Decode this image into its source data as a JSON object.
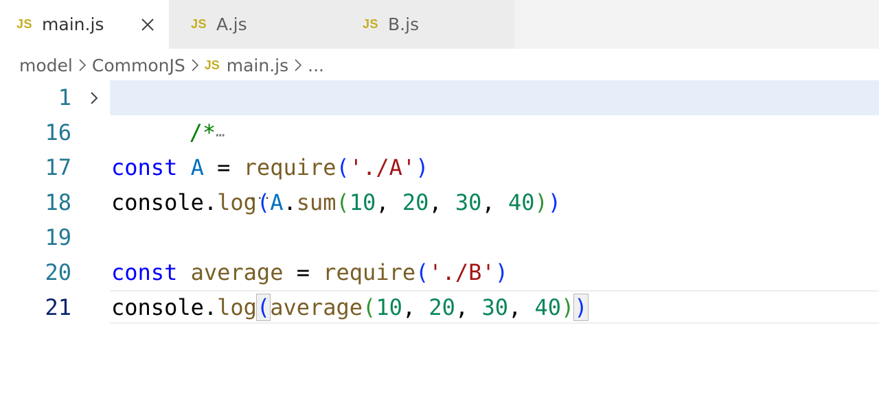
{
  "tabs": [
    {
      "icon_text": "JS",
      "label": "main.js",
      "active": true,
      "close_icon": "close-icon"
    },
    {
      "icon_text": "JS",
      "label": "A.js",
      "active": false
    },
    {
      "icon_text": "JS",
      "label": "B.js",
      "active": false
    }
  ],
  "breadcrumb": {
    "folder1": "model",
    "folder2": "CommonJS",
    "file_icon_text": "JS",
    "file": "main.js",
    "more": "..."
  },
  "editor": {
    "lines": [
      {
        "number": "1",
        "folded": true,
        "comment_start": "/*",
        "fold_ellipsis": "⋯"
      },
      {
        "number": "16"
      },
      {
        "number": "17",
        "tokens": {
          "kw": "const",
          "var": "A",
          "op": "=",
          "fn": "require",
          "open": "(",
          "str": "'./A'",
          "close": ")"
        }
      },
      {
        "number": "18",
        "tokens": {
          "obj": "console",
          "dot": ".",
          "fn": "log",
          "open1": "(",
          "var": "A",
          "dot2": ".",
          "fn2": "sum",
          "open2": "(",
          "n1": "10",
          "n2": "20",
          "n3": "30",
          "n4": "40",
          "close2": ")",
          "close1": ")"
        }
      },
      {
        "number": "19"
      },
      {
        "number": "20",
        "tokens": {
          "kw": "const",
          "fn": "average",
          "op": "=",
          "fn2": "require",
          "open": "(",
          "str": "'./B'",
          "close": ")"
        }
      },
      {
        "number": "21",
        "current": true,
        "tokens": {
          "obj": "console",
          "dot": ".",
          "fn": "log",
          "open1": "(",
          "fn2": "average",
          "open2": "(",
          "n1": "10",
          "n2": "20",
          "n3": "30",
          "n4": "40",
          "close2": ")",
          "close1": ")"
        }
      }
    ],
    "inline_hint": "..."
  },
  "colors": {
    "js_icon": "#c4ad22",
    "keyword": "#0000ff",
    "variable": "#0070c1",
    "function": "#795e26",
    "string": "#a31515",
    "number": "#098658",
    "comment": "#008000",
    "line_number": "#237893",
    "active_line_number": "#0b216f"
  }
}
